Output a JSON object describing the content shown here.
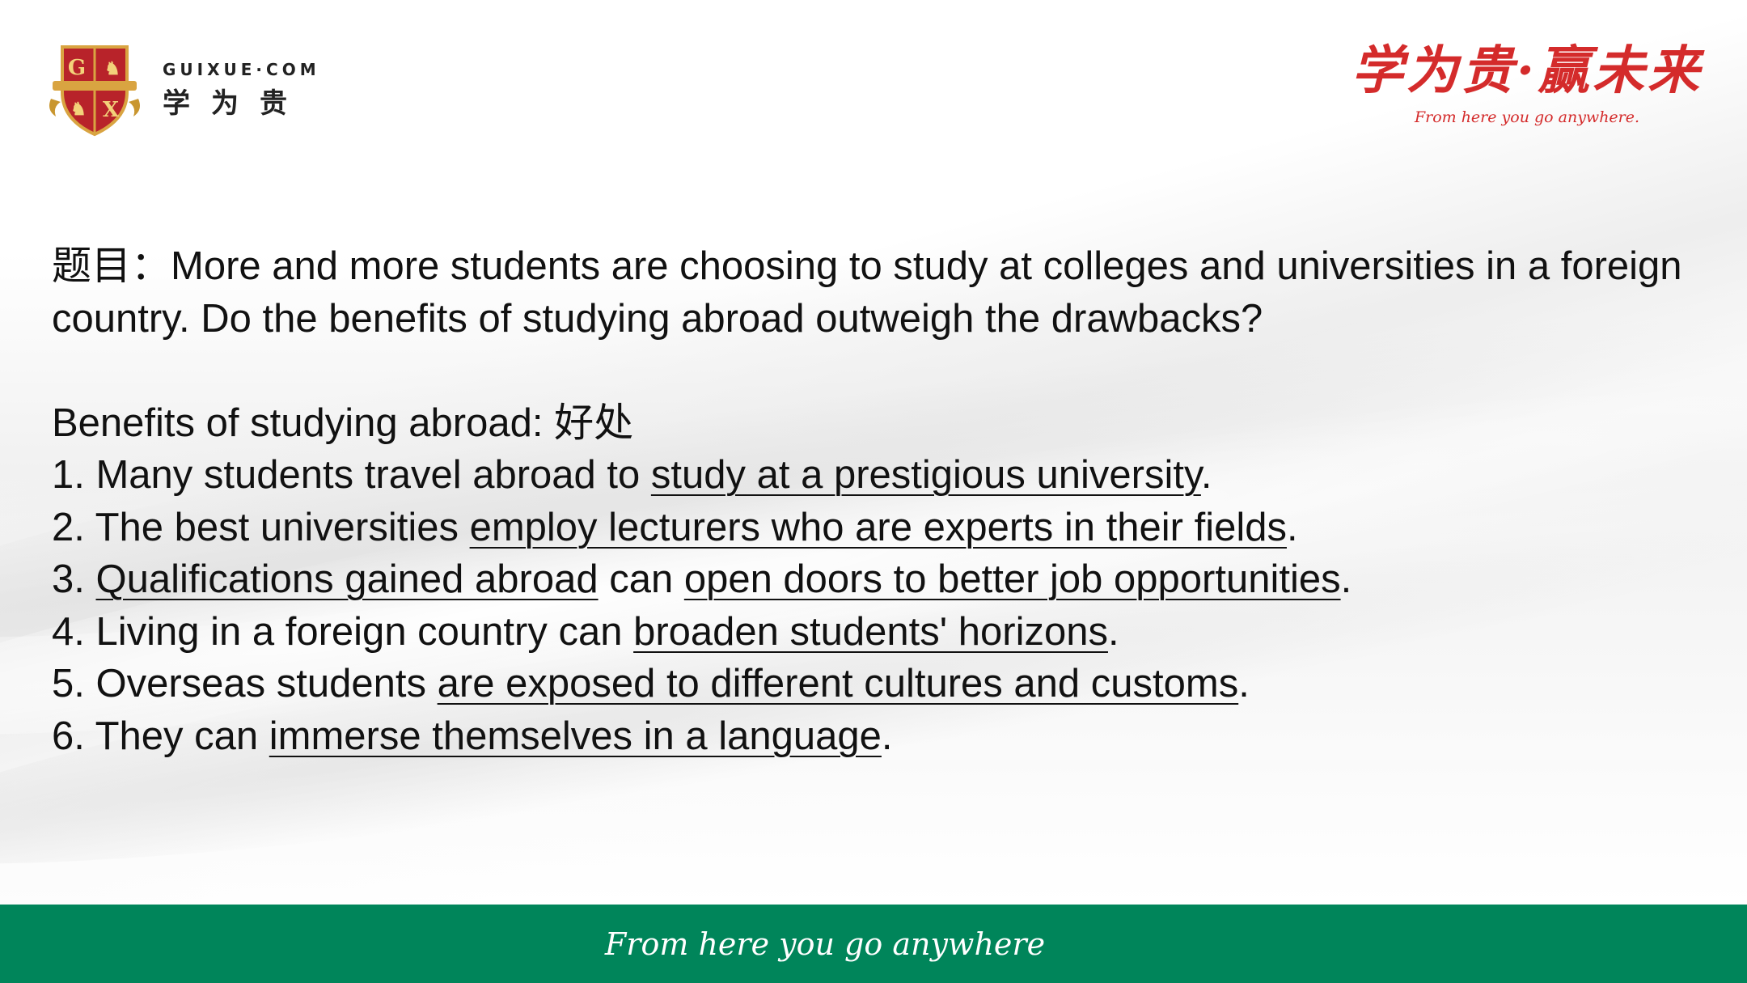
{
  "logo_left": {
    "domain": "GUIXUE·COM",
    "name_cn": "学为贵"
  },
  "logo_right": {
    "slogan_cn": "学为贵·赢未来",
    "slogan_en": "From here you go anywhere."
  },
  "question": {
    "label": "题目：",
    "text": "More and more students are choosing to study at colleges and universities in a foreign country. Do the benefits of studying abroad outweigh the drawbacks?"
  },
  "benefits": {
    "heading": "Benefits of studying abroad: ",
    "heading_cn": "好处",
    "items": [
      {
        "num": "1. ",
        "p1": "Many students travel abroad to ",
        "u1": "study at a prestigious university",
        "p2": ".",
        "u2": "",
        "p3": ""
      },
      {
        "num": "2. ",
        "p1": "The best universities ",
        "u1": "employ lecturers who are experts in their fields",
        "p2": ".",
        "u2": "",
        "p3": ""
      },
      {
        "num": "3. ",
        "p1": "",
        "u1": "Qualifications gained abroad",
        "p2": " can ",
        "u2": "open doors to better job opportunities",
        "p3": "."
      },
      {
        "num": "4. ",
        "p1": "Living in a foreign country can ",
        "u1": "broaden students' horizons",
        "p2": ".",
        "u2": "",
        "p3": ""
      },
      {
        "num": "5. ",
        "p1": "Overseas students ",
        "u1": "are exposed to different cultures and customs",
        "p2": ".",
        "u2": "",
        "p3": ""
      },
      {
        "num": "6. ",
        "p1": "They can ",
        "u1": "immerse themselves in a language",
        "p2": ".",
        "u2": "",
        "p3": ""
      }
    ]
  },
  "footer": {
    "tagline": "From here you go anywhere"
  },
  "colors": {
    "brand_red": "#d42b2b",
    "footer_green": "#00855a",
    "shield_red": "#b8232a",
    "shield_gold": "#d9a441"
  }
}
